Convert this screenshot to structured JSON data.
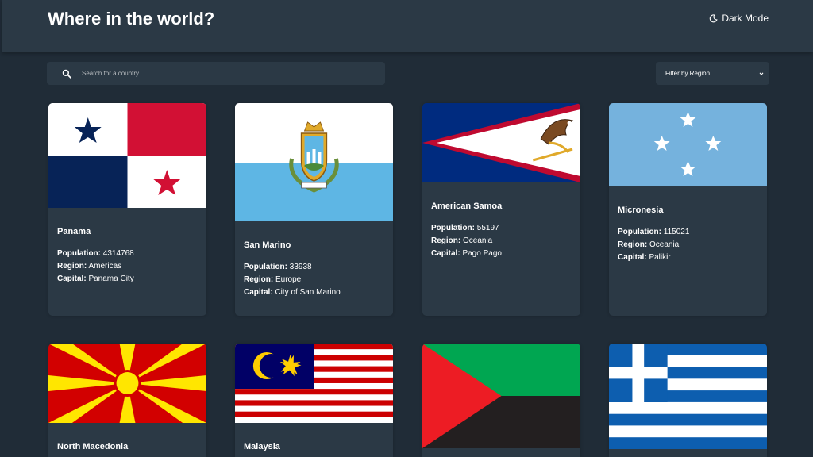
{
  "header": {
    "title": "Where in the world?",
    "theme_toggle_label": "Dark Mode"
  },
  "search": {
    "placeholder": "Search for a country..."
  },
  "filter": {
    "label": "Filter by Region"
  },
  "stat_labels": {
    "population": "Population:",
    "region": "Region:",
    "capital": "Capital:"
  },
  "countries": [
    {
      "name": "Panama",
      "population": "4314768",
      "region": "Americas",
      "capital": "Panama City"
    },
    {
      "name": "San Marino",
      "population": "33938",
      "region": "Europe",
      "capital": "City of San Marino"
    },
    {
      "name": "American Samoa",
      "population": "55197",
      "region": "Oceania",
      "capital": "Pago Pago"
    },
    {
      "name": "Micronesia",
      "population": "115021",
      "region": "Oceania",
      "capital": "Palikir"
    },
    {
      "name": "North Macedonia"
    },
    {
      "name": "Malaysia"
    },
    {
      "name": ""
    },
    {
      "name": ""
    }
  ],
  "colors": {
    "background": "#202c37",
    "elements": "#2b3945",
    "text": "#ffffff"
  }
}
